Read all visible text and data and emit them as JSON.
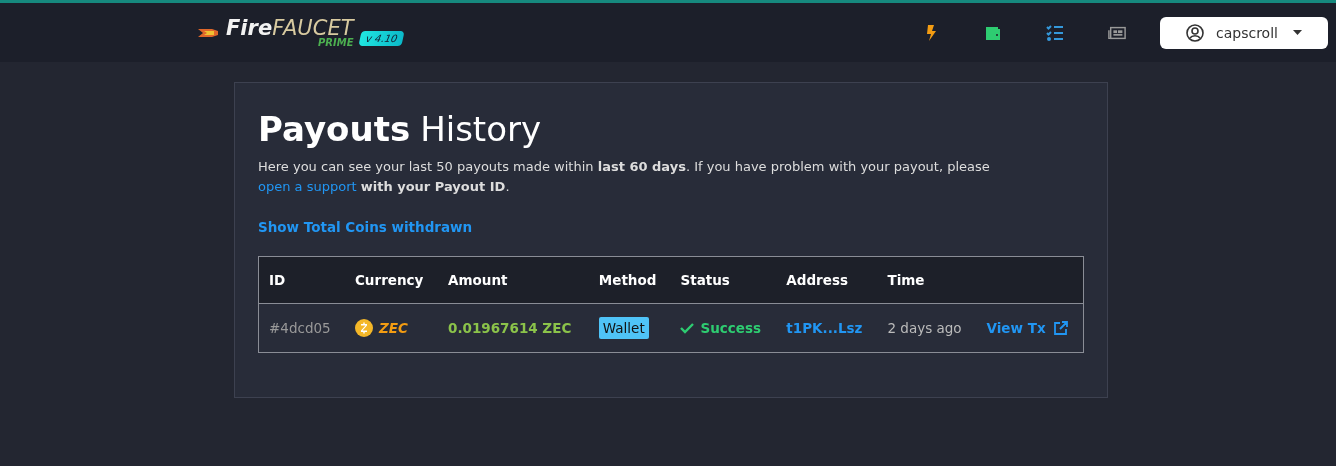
{
  "header": {
    "logo": {
      "fire": "Fire",
      "faucet": "FAUCET",
      "prime": "PRIME",
      "version": "v 4.10"
    },
    "user": {
      "name": "capscroll"
    }
  },
  "card": {
    "title_bold": "Payouts",
    "title_rest": "History",
    "intro": "Here you can see your last 50 payouts made within **last 60 days**. If you have problem with your payout, please ",
    "support_link": "open a support",
    "intro_end": "**with your Payout ID**.",
    "total_link": "Show Total Coins withdrawn",
    "table": {
      "columns": [
        "ID",
        "Currency",
        "Amount",
        "Method",
        "Status",
        "Address",
        "Time"
      ],
      "rows": [
        {
          "id": "#4dcd05",
          "currency": "ZEC",
          "amount": "0.01967614 ZEC",
          "method": "Wallet",
          "status": {
            "kind": "success",
            "label": "Success"
          },
          "address": "t1PK...Lsz",
          "time": "2 days ago",
          "action": "View Tx"
        }
      ]
    }
  }
}
